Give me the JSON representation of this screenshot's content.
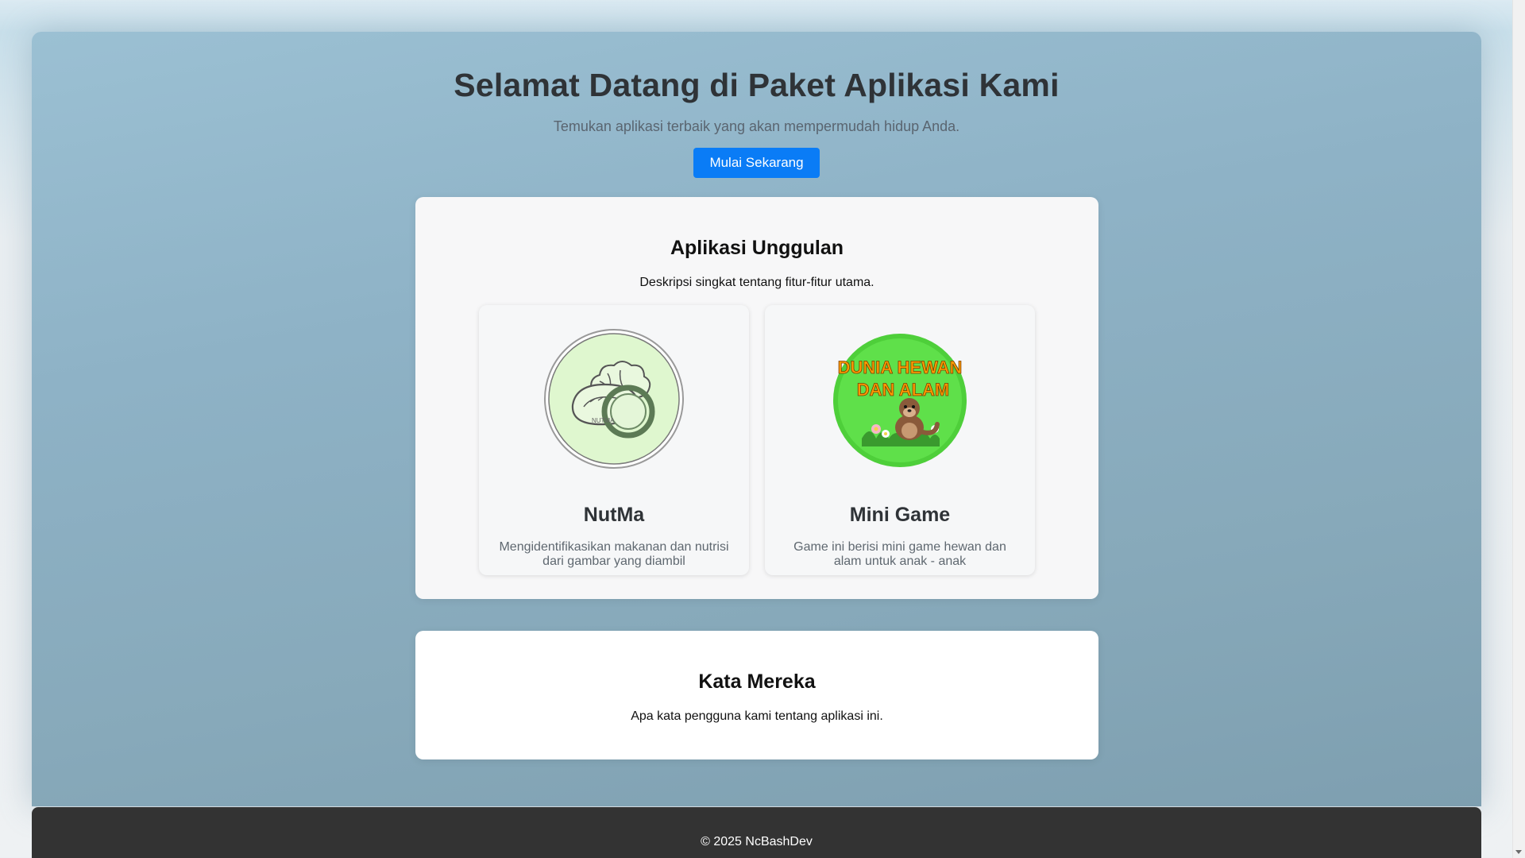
{
  "hero": {
    "title": "Selamat Datang di Paket Aplikasi Kami",
    "subtitle": "Temukan aplikasi terbaik yang akan mempermudah hidup Anda.",
    "cta_label": "Mulai Sekarang"
  },
  "featured": {
    "title": "Aplikasi Unggulan",
    "description": "Deskripsi singkat tentang fitur-fitur utama.",
    "apps": [
      {
        "name": "NutMa",
        "description": "Mengidentifikasikan makanan dan nutrisi dari gambar yang diambil",
        "icon": "food-plate-icon"
      },
      {
        "name": "Mini Game",
        "description": "Game ini berisi mini game hewan dan alam untuk anak - anak",
        "icon": "otter-logo-icon",
        "logo_text": "DUNIA HEWAN DAN ALAM"
      }
    ]
  },
  "testimonials": {
    "title": "Kata Mereka",
    "description": "Apa kata pengguna kami tentang aplikasi ini."
  },
  "footer": {
    "text": "© 2025 NcBashDev"
  },
  "colors": {
    "primary": "#0a7cf6",
    "footer_bg": "#333333",
    "nutma_bg": "#dff7cf",
    "minigame_bg": "#5fe04a"
  }
}
